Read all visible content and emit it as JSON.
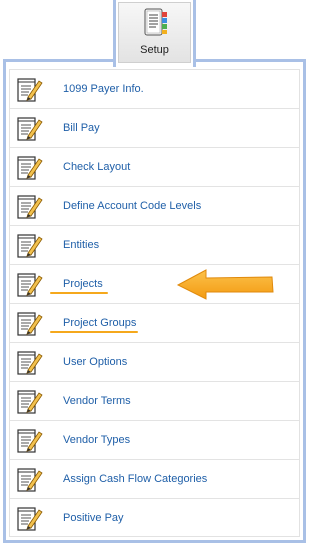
{
  "setup_tab": {
    "label": "Setup",
    "icon": "setup-book-icon"
  },
  "menu": {
    "items": [
      {
        "label": "1099 Payer Info.",
        "icon": "notepad-pencil-icon"
      },
      {
        "label": "Bill Pay",
        "icon": "notepad-pencil-icon"
      },
      {
        "label": "Check Layout",
        "icon": "notepad-pencil-icon"
      },
      {
        "label": "Define Account Code Levels",
        "icon": "notepad-pencil-icon"
      },
      {
        "label": "Entities",
        "icon": "notepad-pencil-icon"
      },
      {
        "label": "Projects",
        "icon": "notepad-pencil-icon",
        "highlighted": true
      },
      {
        "label": "Project Groups",
        "icon": "notepad-pencil-icon",
        "highlighted": true
      },
      {
        "label": "User Options",
        "icon": "notepad-pencil-icon"
      },
      {
        "label": "Vendor Terms",
        "icon": "notepad-pencil-icon"
      },
      {
        "label": "Vendor Types",
        "icon": "notepad-pencil-icon"
      },
      {
        "label": "Assign Cash Flow Categories",
        "icon": "notepad-pencil-icon"
      },
      {
        "label": "Positive Pay",
        "icon": "notepad-pencil-icon"
      }
    ]
  },
  "annotation": {
    "arrow_icon": "orange-arrow-icon",
    "highlight_color": "#f5a81c",
    "link_color": "#1f5fa8",
    "frame_color": "#a9c0e6"
  }
}
